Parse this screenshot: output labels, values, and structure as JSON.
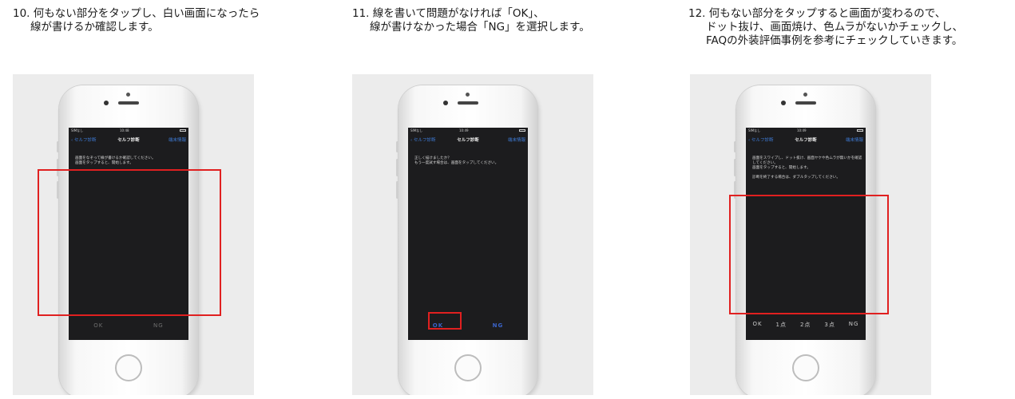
{
  "steps": [
    {
      "caption": [
        "10. 何もない部分をタップし、白い画面になったら",
        "線が書けるか確認します。"
      ],
      "screen": {
        "status_carrier": "SIMなし",
        "status_time": "10:48",
        "nav_back": "セルフ診断",
        "nav_title": "セルフ診断",
        "nav_right": "端末情報",
        "body_text": "画面をなぞって線が書けるか確認してください。\n画面をタップすると、開始します。",
        "buttons": [
          "OK",
          "NG"
        ]
      }
    },
    {
      "caption": [
        "11. 線を書いて問題がなければ「OK」、",
        "線が書けなかった場合「NG」を選択します。"
      ],
      "screen": {
        "status_carrier": "SIMなし",
        "status_time": "10:49",
        "nav_back": "セルフ診断",
        "nav_title": "セルフ診断",
        "nav_right": "端末情報",
        "body_text": "正しく描けましたか？\nもう一度試す場合は、画面をタップしてください。",
        "buttons": [
          "OK",
          "NG"
        ]
      }
    },
    {
      "caption": [
        "12. 何もない部分をタップすると画面が変わるので、",
        "ドット抜け、画面焼け、色ムラがないかチェックし、",
        "FAQの外装評価事例を参考にチェックしていきます。"
      ],
      "screen": {
        "status_carrier": "SIMなし",
        "status_time": "10:49",
        "nav_back": "セルフ診断",
        "nav_title": "セルフ診断",
        "nav_right": "端末情報",
        "body_text": "画面をスワイプし、ドット抜け、画面ヤケや色ムラが無いかを確認してください。\n画面をタップすると、開始します。\n\n診断を終了する場合は、ダブルタップしてください。",
        "buttons": [
          "OK",
          "1点",
          "2点",
          "3点",
          "NG"
        ]
      }
    }
  ],
  "colors": {
    "highlight": "#e02020",
    "screen_bg": "#1c1c1e",
    "accent": "#3e7bd6"
  }
}
